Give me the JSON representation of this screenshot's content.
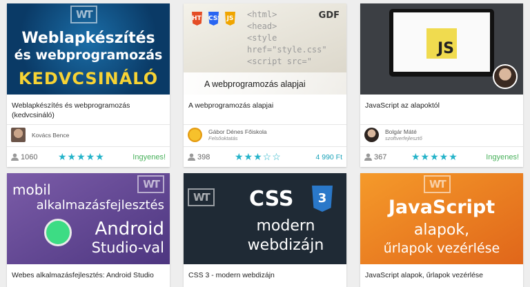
{
  "courses": [
    {
      "title": "Weblapkészítés és webprogramozás (kedvcsináló)",
      "author": "Kovács Bence",
      "author_subtitle": "",
      "learners": "1060",
      "rating": 5,
      "price": "Ingyenes!",
      "thumb": {
        "line1": "Weblapkészítés",
        "line2": "és webprogramozás",
        "line3": "KEDVCSINÁLÓ"
      }
    },
    {
      "title": "A webprogramozás alapjai",
      "author": "Gábor Dénes Főiskola",
      "author_subtitle": "Felsőoktatás",
      "learners": "398",
      "rating": 3,
      "price": "4 990 Ft",
      "thumb": {
        "code1": "<html>",
        "code2": "<head>",
        "code3": "<style href=\"style.css\"",
        "code4": "<script src=\"",
        "html_badge": "HTML",
        "css_badge": "CSS",
        "js_badge": "JS",
        "band_text": "A webprogramozás alapjai",
        "logo": "GDF"
      }
    },
    {
      "title": "JavaScript az alapoktól",
      "author": "Bolgár Máté",
      "author_subtitle": "szoftverfejlesztő",
      "learners": "367",
      "rating": 5,
      "price": "Ingyenes!",
      "thumb": {
        "js_logo": "JS"
      }
    },
    {
      "title": "Webes alkalmazásfejlesztés: Android Studio",
      "thumb": {
        "line1": "mobil",
        "line2": "alkalmazásfejlesztés",
        "line3": "Android",
        "line4": "Studio-val"
      }
    },
    {
      "title": "CSS 3 - modern webdizájn",
      "thumb": {
        "css": "CSS",
        "badge": "3",
        "line1": "modern",
        "line2": "webdizájn"
      }
    },
    {
      "title": "JavaScript alapok, űrlapok vezérlése",
      "thumb": {
        "line1": "JavaScript",
        "line2": "alapok,",
        "line3": "űrlapok vezérlése"
      }
    }
  ],
  "brand_mark": "WT",
  "colors": {
    "star": "#24b3c9",
    "free": "#47b05a",
    "price": "#19a2b8"
  },
  "icons": {
    "learners": "person-icon",
    "star": "star-icon"
  }
}
